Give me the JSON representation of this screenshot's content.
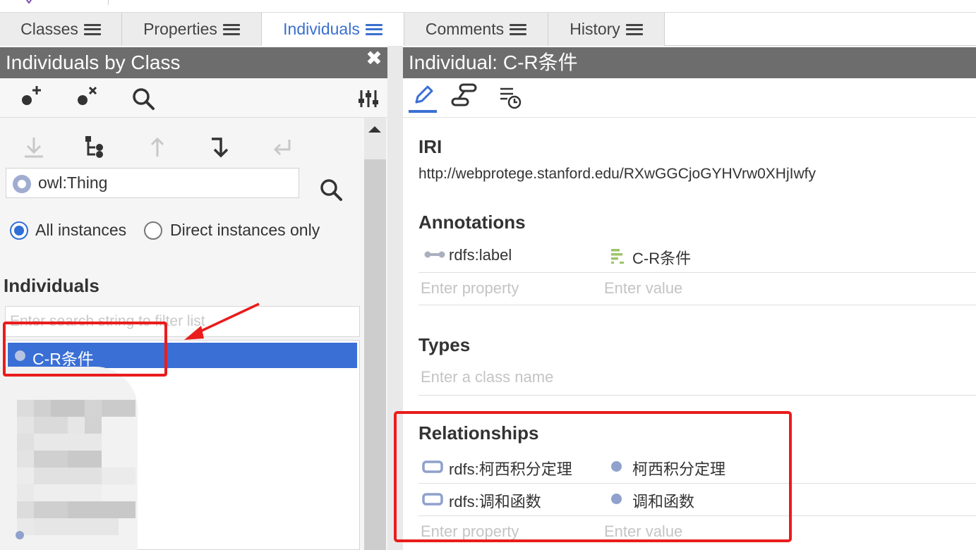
{
  "tabs": [
    {
      "label": "Classes",
      "active": false
    },
    {
      "label": "Properties",
      "active": false
    },
    {
      "label": "Individuals",
      "active": true
    },
    {
      "label": "Comments",
      "active": false
    },
    {
      "label": "History",
      "active": false
    }
  ],
  "left_panel": {
    "title": "Individuals by Class",
    "toolbar_icons": [
      "add-individual-icon",
      "delete-individual-icon",
      "search-icon",
      "settings-sliders-icon"
    ],
    "nav_icons": [
      "move-down-icon",
      "hierarchy-icon",
      "move-up-icon",
      "go-down-icon",
      "go-back-icon"
    ],
    "class_selector": {
      "value": "owl:Thing"
    },
    "radio_all": "All instances",
    "radio_direct": "Direct instances only",
    "individuals_title": "Individuals",
    "filter_placeholder": "Enter search string to filter list",
    "selected_individual": "C-R条件"
  },
  "right_panel": {
    "title": "Individual: C-R条件",
    "iri_title": "IRI",
    "iri_value": "http://webprotege.stanford.edu/RXwGGCjoGYHVrw0XHjIwfy",
    "annotations_title": "Annotations",
    "annotation_rows": [
      {
        "property": "rdfs:label",
        "value": "C-R条件"
      }
    ],
    "enter_property_placeholder": "Enter property",
    "enter_value_placeholder": "Enter value",
    "types_title": "Types",
    "types_placeholder": "Enter a class name",
    "relationships_title": "Relationships",
    "relationship_rows": [
      {
        "property": "rdfs:柯西积分定理",
        "value": "柯西积分定理"
      },
      {
        "property": "rdfs:调和函数",
        "value": "调和函数"
      }
    ]
  },
  "colors": {
    "accent": "#3a6fd5",
    "header": "#6d6d6d",
    "annotation_red": "#ea1c1c",
    "individual_dot": "#8fa1cc"
  }
}
